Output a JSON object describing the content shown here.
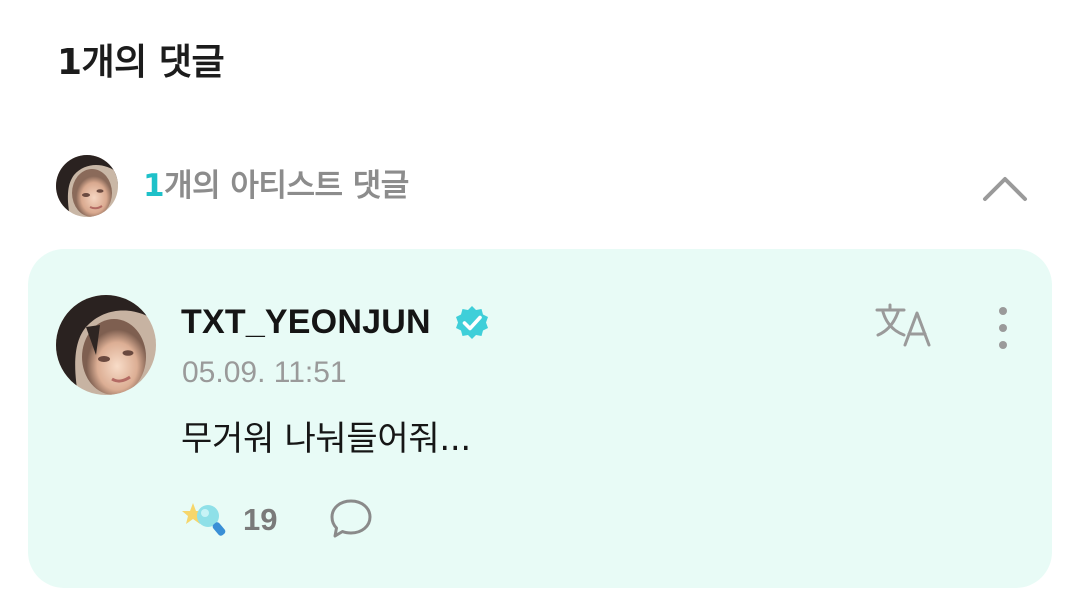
{
  "header": {
    "title": "1개의 댓글"
  },
  "artist_section": {
    "count": "1",
    "label": "개의 아티스트 댓글",
    "avatar_icon": "artist-avatar",
    "collapse_icon": "chevron-up-icon"
  },
  "comment": {
    "username": "TXT_YEONJUN",
    "verified_icon": "verified-badge-icon",
    "timestamp": "05.09. 11:51",
    "text": "무거워 나눠들어줘...",
    "translate_icon": "translate-icon",
    "more_icon": "more-vertical-icon",
    "like_icon": "cheer-light-stick-icon",
    "like_count": "19",
    "reply_icon": "speech-bubble-icon"
  },
  "colors": {
    "accent": "#1ec1c9",
    "card_background": "#e8fbf6",
    "verified": "#3fcfd9"
  }
}
